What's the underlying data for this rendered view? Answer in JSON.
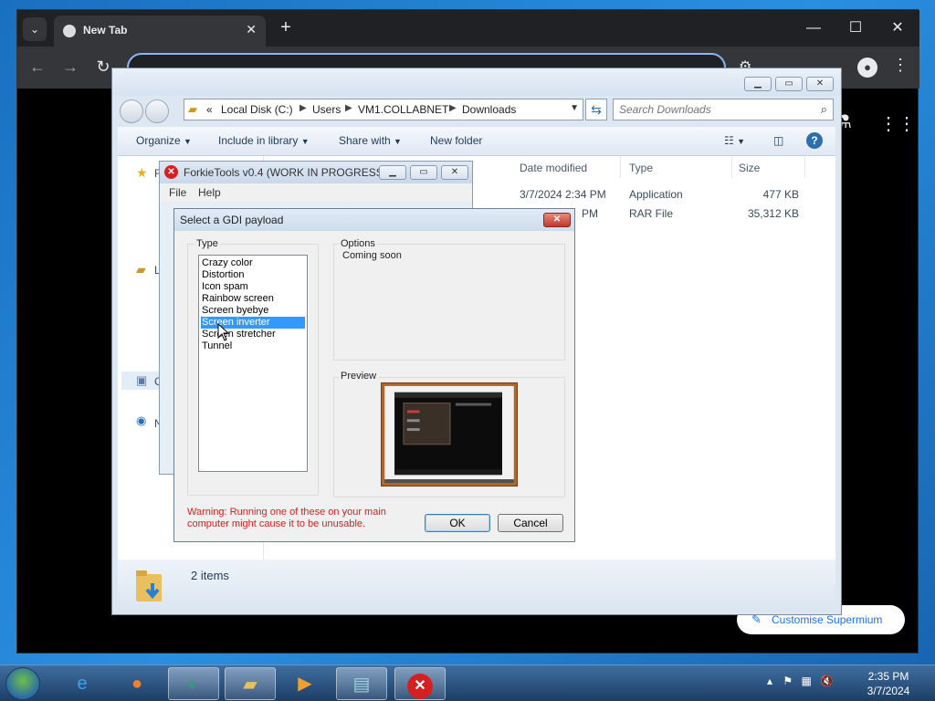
{
  "browser": {
    "tab_title": "New Tab",
    "customise_label": "Customise Supermium"
  },
  "explorer": {
    "breadcrumb": [
      "Local Disk (C:)",
      "Users",
      "VM1.COLLABNET",
      "Downloads"
    ],
    "breadcrumb_prefix": "«",
    "search_placeholder": "Search Downloads",
    "commands": {
      "organize": "Organize",
      "include": "Include in library",
      "share": "Share with",
      "new_folder": "New folder"
    },
    "columns": {
      "date": "Date modified",
      "type": "Type",
      "size": "Size"
    },
    "files": [
      {
        "date": "3/7/2024 2:34 PM",
        "type": "Application",
        "size": "477 KB"
      },
      {
        "date": "3/7/2024 2:34 PM",
        "date_visible": "PM",
        "type": "RAR File",
        "size": "35,312 KB"
      }
    ],
    "nav_labels": [
      "F",
      "L",
      "C",
      "N"
    ],
    "status": "2 items"
  },
  "forkie": {
    "title": "ForkieTools v0.4 (WORK IN PROGRESS)",
    "menu_file": "File",
    "menu_help": "Help"
  },
  "dialog": {
    "title": "Select a GDI payload",
    "type_label": "Type",
    "options_label": "Options",
    "options_text": "Coming soon",
    "preview_label": "Preview",
    "items": [
      "Crazy color",
      "Distortion",
      "Icon spam",
      "Rainbow screen",
      "Screen byebye",
      "Screen inverter",
      "Screen stretcher",
      "Tunnel"
    ],
    "selected_index": 5,
    "warning": "Warning: Running one of these on your main computer might cause it to be unusable.",
    "ok": "OK",
    "cancel": "Cancel"
  },
  "taskbar": {
    "time": "2:35 PM",
    "date": "3/7/2024"
  },
  "colors": {
    "accent": "#3399ff",
    "warning": "#d42020",
    "link": "#1a73e8"
  },
  "icons": [
    "start-orb-icon",
    "ie-icon",
    "firefox-icon",
    "chat-icon",
    "folder-icon",
    "media-player-icon",
    "notepad-icon",
    "error-icon"
  ]
}
